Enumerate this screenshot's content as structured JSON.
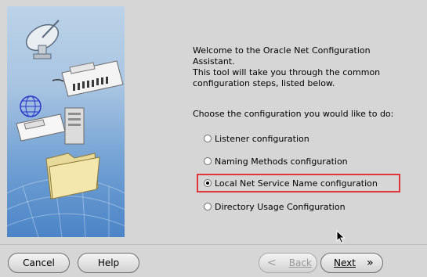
{
  "intro": {
    "lines": [
      "Welcome to the Oracle Net Configuration",
      "Assistant.",
      "This tool will take you through the common",
      "configuration steps, listed below."
    ]
  },
  "prompt": "Choose the configuration you would like to do:",
  "options": [
    {
      "label": "Listener configuration",
      "selected": false
    },
    {
      "label": "Naming Methods configuration",
      "selected": false
    },
    {
      "label": "Local Net Service Name configuration",
      "selected": true
    },
    {
      "label": "Directory Usage Configuration",
      "selected": false
    }
  ],
  "buttons": {
    "cancel": "Cancel",
    "help": "Help",
    "back": "Back",
    "next": "Next",
    "back_chevron": "<",
    "next_chevron": "»"
  },
  "colors": {
    "highlight": "#e0353a",
    "background": "#d6d6d6"
  },
  "icons": [
    "satellite-dish-icon",
    "network-card-icon",
    "globe-icon",
    "computer-icon",
    "folder-icon",
    "mouse-cursor-icon"
  ]
}
